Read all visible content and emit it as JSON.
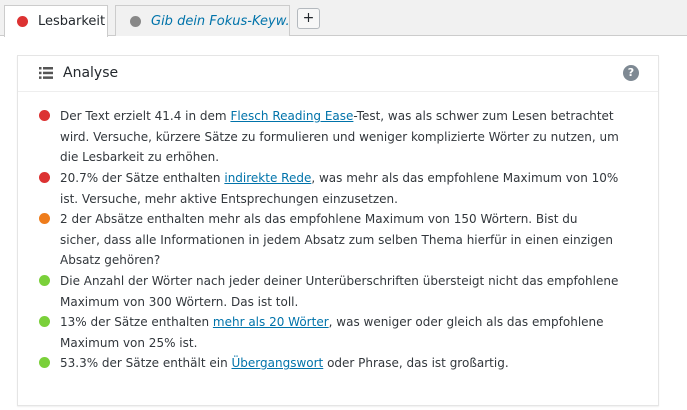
{
  "colors": {
    "bad": "#dc3232",
    "ok": "#ee7c1b",
    "good": "#7ad03a",
    "neutral": "#888888",
    "link": "#0073aa"
  },
  "tabs": [
    {
      "label": "Lesbarkeit",
      "status": "bad",
      "active": true
    },
    {
      "label": "Gib dein Fokus-Keyw...",
      "status": "neutral",
      "active": false
    }
  ],
  "add_tab": {
    "label": "+"
  },
  "panel": {
    "title": "Analyse",
    "title_icon": "list-icon",
    "help_icon": "help-icon",
    "help_label": "?"
  },
  "results": [
    {
      "status": "bad",
      "before": "Der Text erzielt 41.4 in dem ",
      "link": "Flesch Reading Ease",
      "after": "-Test, was als schwer zum Lesen betrachtet wird. Versuche, kürzere Sätze zu formulieren und weniger komplizierte Wörter zu nutzen, um die Lesbarkeit zu erhöhen."
    },
    {
      "status": "bad",
      "before": "20.7% der Sätze enthalten ",
      "link": "indirekte Rede",
      "after": ", was mehr als das empfohlene Maximum von 10% ist. Versuche, mehr aktive Entsprechungen einzusetzen."
    },
    {
      "status": "ok",
      "before": "2 der Absätze enthalten mehr als das empfohlene Maximum von 150 Wörtern. Bist du sicher, dass alle Informationen in jedem Absatz zum selben Thema hierfür in einen einzigen Absatz gehören?",
      "link": "",
      "after": ""
    },
    {
      "status": "good",
      "before": "Die Anzahl der Wörter nach jeder deiner Unterüberschriften übersteigt nicht das empfohlene Maximum von 300 Wörtern. Das ist toll.",
      "link": "",
      "after": ""
    },
    {
      "status": "good",
      "before": "13% der Sätze enthalten ",
      "link": "mehr als 20 Wörter",
      "after": ", was weniger oder gleich als das empfohlene Maximum von 25% ist."
    },
    {
      "status": "good",
      "before": "53.3% der Sätze enthält ein ",
      "link": "Übergangswort",
      "after": " oder Phrase, das ist großartig."
    }
  ]
}
